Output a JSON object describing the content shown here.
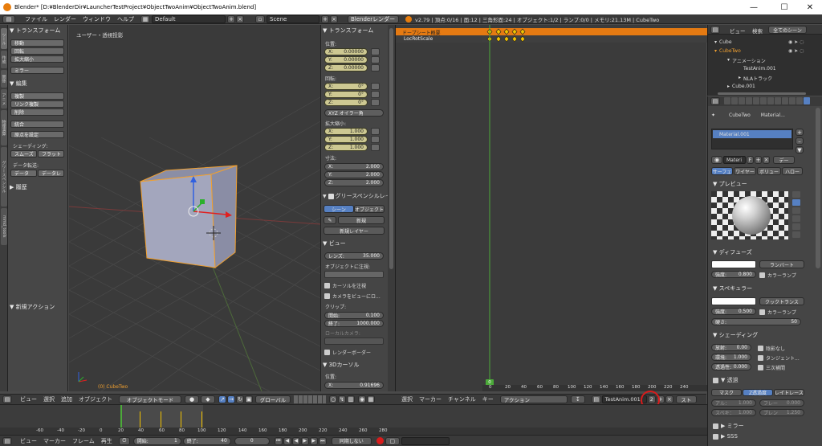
{
  "window": {
    "title": "Blender* [D:¥BlenderDir¥LauncherTestProject¥ObjectTwoAnim¥ObjectTwoAnim.blend]",
    "min": "—",
    "max": "☐",
    "close": "✕"
  },
  "topbar": {
    "menus": [
      "ファイル",
      "レンダー",
      "ウィンドウ",
      "ヘルプ"
    ],
    "layout": "Default",
    "scene": "Scene",
    "engine": "Blenderレンダー",
    "stats": "v2.79 | 頂点:0/16 | 面:12 | 三角形面:24 | オブジェクト:1/2 | ランプ:0/0 | メモリ:21.13M | CubeTwo"
  },
  "tabs": [
    "ツール",
    "作成",
    "関係",
    "アニメ",
    "物理演算",
    "グリースペンシル",
    "mmd_tools"
  ],
  "shelf": {
    "transform_title": "▼ トランスフォーム",
    "transform_btns": [
      "移動",
      "回転",
      "拡大縮小"
    ],
    "mirror": "ミラー",
    "edit_title": "▼ 編集",
    "edit_btns": [
      "複製",
      "リンク複製",
      "削除"
    ],
    "join": "統合",
    "origin": "原点を設定",
    "shading_label": "シェーディング:",
    "smooth": "スムーズ",
    "flat": "フラット",
    "data_label": "データ転送:",
    "data": "データ",
    "data_layer": "データレ",
    "history": "▶ 履歴",
    "new_action": "▼ 新規アクション"
  },
  "viewport": {
    "label": "ユーザー・透視投影",
    "object": "(0) CubeTwo"
  },
  "npanel": {
    "transform_title": "▼ トランスフォーム",
    "loc_label": "位置:",
    "loc": [
      {
        "k": "X:",
        "v": "0.00000"
      },
      {
        "k": "Y:",
        "v": "0.00000"
      },
      {
        "k": "Z:",
        "v": "0.00000"
      }
    ],
    "rot_label": "回転:",
    "rot": [
      {
        "k": "X:",
        "v": "0°"
      },
      {
        "k": "Y:",
        "v": "0°"
      },
      {
        "k": "Z:",
        "v": "0°"
      }
    ],
    "euler": "XYZ オイラー角",
    "scale_label": "拡大縮小:",
    "scale": [
      {
        "k": "X:",
        "v": "1.000"
      },
      {
        "k": "Y:",
        "v": "1.000"
      },
      {
        "k": "Z:",
        "v": "1.000"
      }
    ],
    "dim_label": "寸法:",
    "dim": [
      {
        "k": "X:",
        "v": "2.000"
      },
      {
        "k": "Y:",
        "v": "2.000"
      },
      {
        "k": "Z:",
        "v": "2.000"
      }
    ],
    "gp_title": "グリースペンシルレイ",
    "gp_scene": "シーン",
    "gp_object": "オブジェクト",
    "gp_new": "新規",
    "gp_new_layer": "新規レイヤー",
    "view_title": "▼ ビュー",
    "lens_k": "レンズ:",
    "lens_v": "35.000",
    "lock_obj_label": "オブジェクトに注視:",
    "cursor_lock": "カーソルを注視",
    "camera_lock": "カメラをビューにロ...",
    "clip_label": "クリップ:",
    "clip_start_k": "開始:",
    "clip_start_v": "0.100",
    "clip_end_k": "終了:",
    "clip_end_v": "1000.000",
    "local_camera": "ローカルカメラ:",
    "render_border": "レンダーボーダー",
    "cursor_title": "▼ 3Dカーソル",
    "cursor_loc": "位置:",
    "cursor_x_k": "X:",
    "cursor_x_v": "0.91696"
  },
  "dopesheet": {
    "summary": "ドープシート概要",
    "channel": "LocRotScale",
    "ticks": [
      "0",
      "20",
      "40",
      "60",
      "80",
      "100",
      "120",
      "140",
      "160",
      "180",
      "200",
      "220",
      "240"
    ],
    "current_frame": "0"
  },
  "outliner": {
    "view": "ビュー",
    "search": "検索",
    "filter": "全てのシーン",
    "items": [
      "Cube",
      "CubeTwo",
      "アニメーション",
      "TestAnim.001",
      "NLAトラック",
      "Cube.001"
    ]
  },
  "props": {
    "obj": "CubeTwo",
    "mat_crumb": "Material...",
    "slot": "Material.001",
    "mat_name": "Materi",
    "f": "F",
    "data": "デー",
    "tabs": [
      "サーフェ",
      "ワイヤー",
      "ボリュー",
      "ハロー"
    ],
    "preview": "▼ プレビュー",
    "diffuse": "▼ ディフューズ",
    "lambert": "ランバート",
    "intensity_k": "強度:",
    "diff_int": "0.800",
    "ramp": "カラーランプ",
    "specular": "▼ スペキュラー",
    "cooktorr": "クックトランス",
    "spec_int": "0.500",
    "hardness_k": "硬さ:",
    "hardness": "50",
    "shading": "▼ シェーディング",
    "emit_k": "放射:",
    "emit": "0.00",
    "shadeless": "陰影なし",
    "ambient_k": "環境:",
    "ambient": "1.000",
    "tangent": "タンジェント...",
    "translucency_k": "透過性:",
    "translucency": "0.000",
    "cubic": "三次補間",
    "transp": "▼ 透過",
    "mask": "マスク",
    "ztransp": "Z透過度",
    "raytrace": "レイトレース",
    "alpha_k": "アル：",
    "alpha": "1.000",
    "fresnel_k": "フレー",
    "fresnel": "0.000",
    "specular_t_k": "スペキ：",
    "specular_t": "1.000",
    "blend_k": "ブレン",
    "blend": "1.250",
    "mirror": "▶ ミラー",
    "sss": "▶ SSS"
  },
  "view3d_header": {
    "menus": [
      "ビュー",
      "選択",
      "追加",
      "オブジェクト"
    ],
    "mode": "オブジェクトモード",
    "orientation": "グローバル"
  },
  "dope_header": {
    "menus": [
      "選択",
      "マーカー",
      "チャンネル",
      "キー"
    ],
    "mode": "アクション",
    "action": "TestAnim.001",
    "users": "2",
    "stash": "スト"
  },
  "timeline": {
    "ticks": [
      "-60",
      "-40",
      "-20",
      "0",
      "20",
      "40",
      "60",
      "80",
      "100",
      "120",
      "140",
      "160",
      "180",
      "200",
      "220",
      "240",
      "260",
      "280"
    ],
    "menus": [
      "ビュー",
      "マーカー",
      "フレーム",
      "再生"
    ],
    "start_k": "開始:",
    "start": "1",
    "end_k": "終了:",
    "end": "40",
    "current": "0",
    "sync": "同期しない"
  },
  "colors": {
    "accent": "#e87d0d",
    "selected_blue": "#5680c2",
    "highlight_circle": "#d91c1c",
    "keyframe": "#f2c200",
    "frame_green": "#4caa3a"
  }
}
